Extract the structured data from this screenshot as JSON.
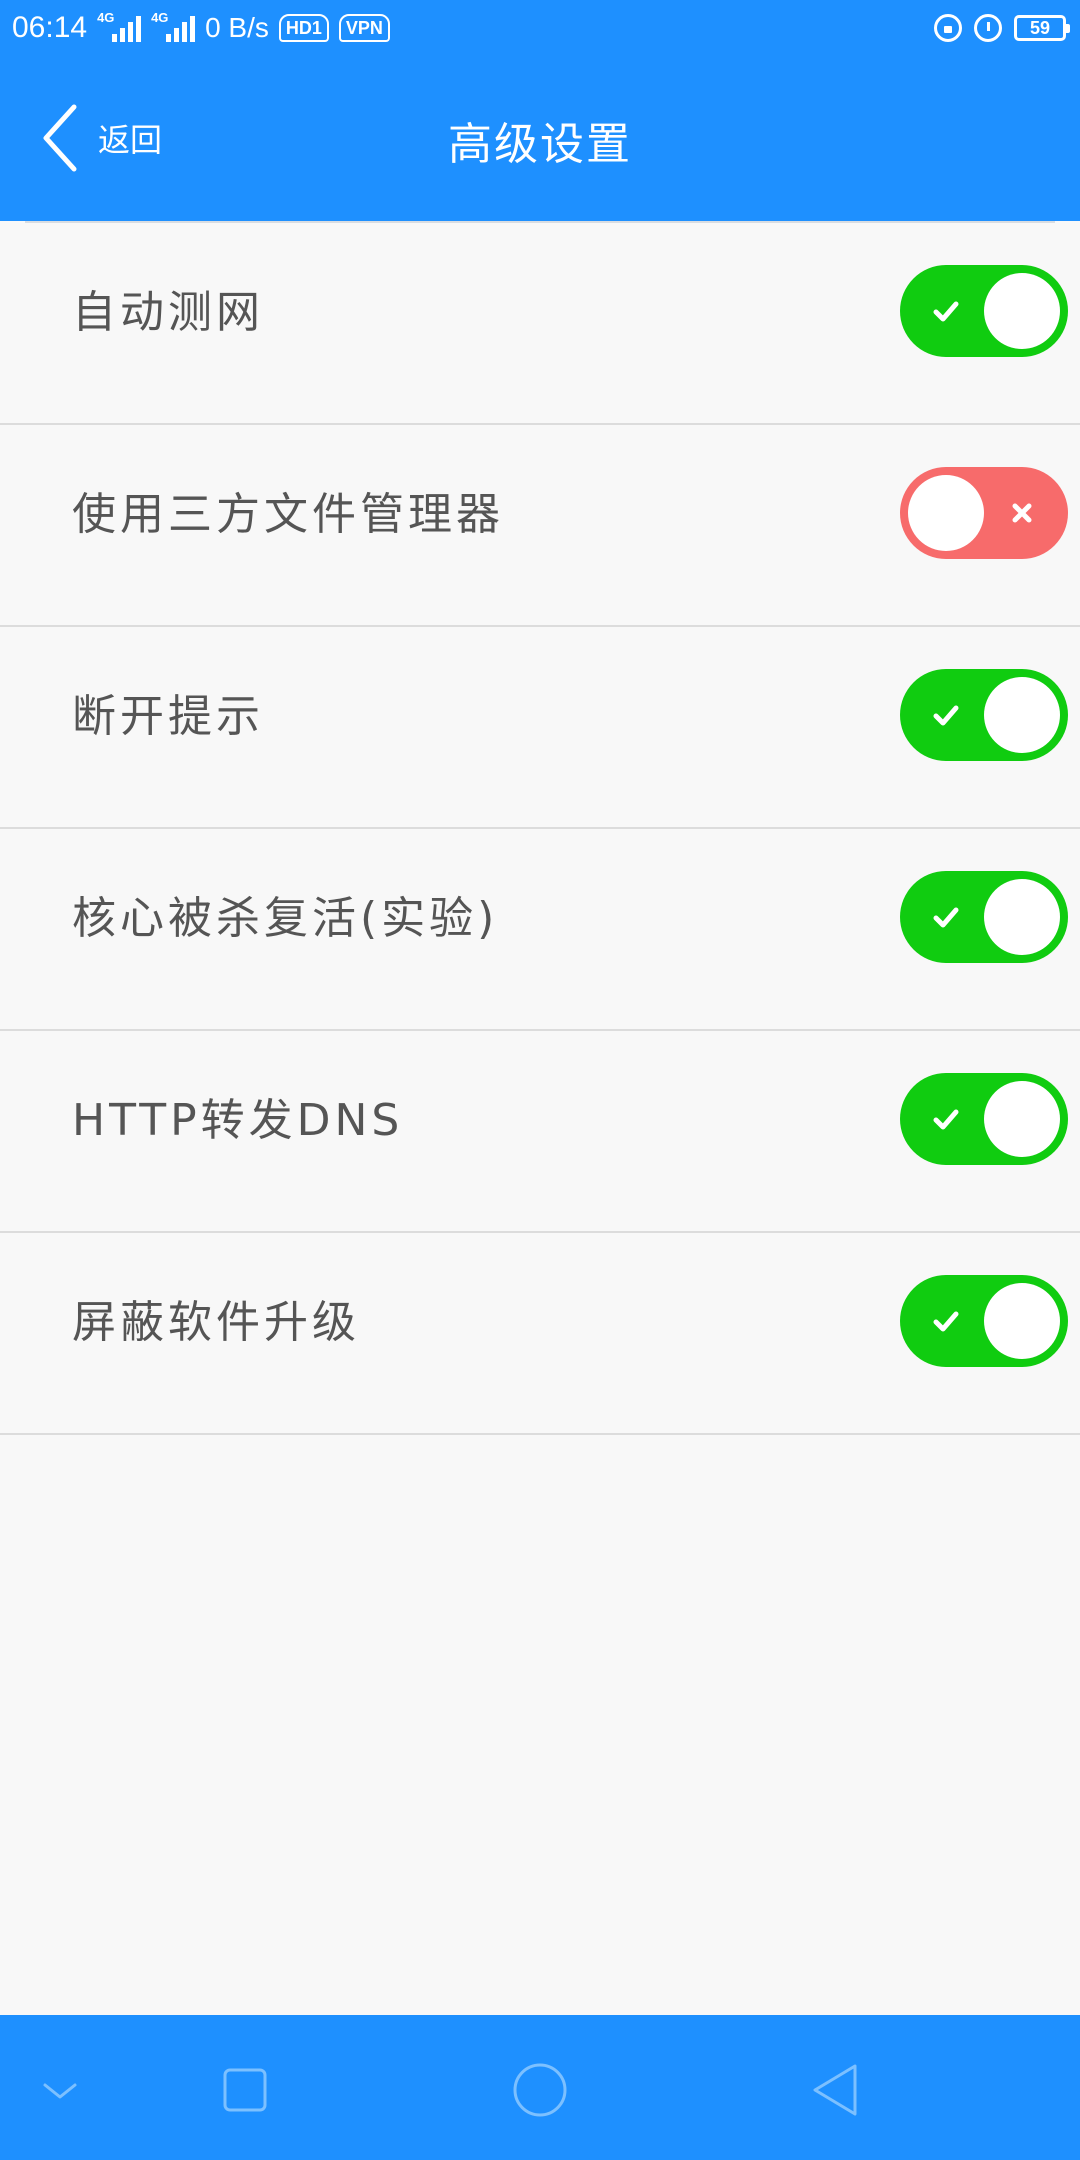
{
  "status_bar": {
    "time": "06:14",
    "network_type_1": "4G",
    "network_type_2": "4G",
    "speed": "0 B/s",
    "hd_badge": "HD1",
    "vpn_badge": "VPN",
    "battery": "59",
    "icons": [
      "signal-icon",
      "signal-icon",
      "hd-icon",
      "vpn-icon",
      "lock-icon",
      "alarm-icon",
      "battery-icon"
    ]
  },
  "header": {
    "back_label": "返回",
    "title": "高级设置",
    "background_color": "#1e90ff"
  },
  "settings": [
    {
      "label": "自动测网",
      "enabled": true
    },
    {
      "label": "使用三方文件管理器",
      "enabled": false
    },
    {
      "label": "断开提示",
      "enabled": true
    },
    {
      "label": "核心被杀复活(实验)",
      "enabled": true
    },
    {
      "label": "HTTP转发DNS",
      "enabled": true
    },
    {
      "label": "屏蔽软件升级",
      "enabled": true
    }
  ],
  "colors": {
    "toggle_on": "#10cc10",
    "toggle_off": "#f76b6b",
    "label_text": "#555555"
  },
  "nav_bar": {
    "icons": [
      "chevron-down-icon",
      "square-icon",
      "circle-icon",
      "triangle-back-icon"
    ]
  }
}
